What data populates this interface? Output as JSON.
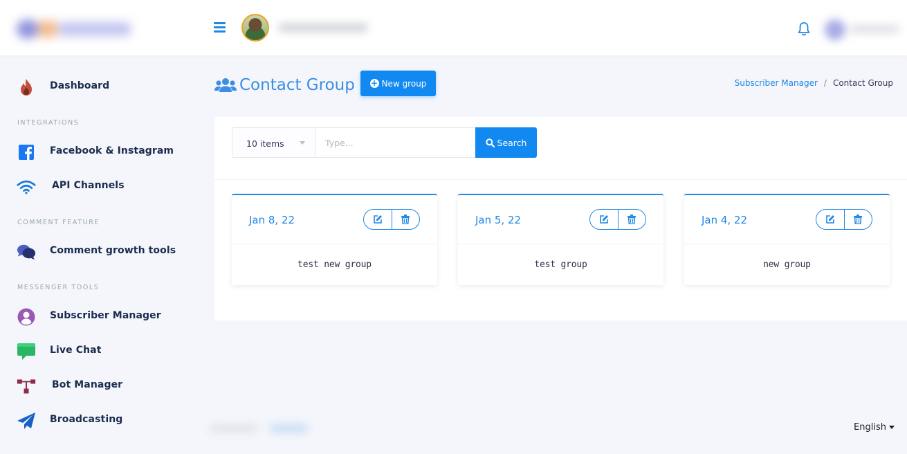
{
  "header": {
    "notifications_icon": "bell-icon",
    "menu_icon": "hamburger-icon"
  },
  "sidebar": {
    "items": [
      {
        "label": "Dashboard",
        "icon": "fire-icon"
      },
      {
        "label": "Facebook & Instagram",
        "icon": "facebook-icon"
      },
      {
        "label": "API Channels",
        "icon": "wifi-icon"
      },
      {
        "label": "Comment growth tools",
        "icon": "comments-icon"
      },
      {
        "label": "Subscriber Manager",
        "icon": "user-circle-icon"
      },
      {
        "label": "Live Chat",
        "icon": "chat-bubble-icon"
      },
      {
        "label": "Bot Manager",
        "icon": "sitemap-icon"
      },
      {
        "label": "Broadcasting",
        "icon": "paper-plane-icon"
      }
    ],
    "sections": {
      "integrations": "INTEGRATIONS",
      "comment_feature": "COMMENT FEATURE",
      "messenger_tools": "MESSENGER TOOLS"
    }
  },
  "page": {
    "title": "Contact Group",
    "new_button": "New group",
    "breadcrumb": {
      "parent": "Subscriber Manager",
      "separator": "/",
      "current": "Contact Group"
    }
  },
  "filter": {
    "items_select": "10 items",
    "search_placeholder": "Type...",
    "search_button": "Search"
  },
  "groups": [
    {
      "date": "Jan 8, 22",
      "name": "test new group"
    },
    {
      "date": "Jan 5, 22",
      "name": "test group"
    },
    {
      "date": "Jan 4, 22",
      "name": "new group"
    }
  ],
  "footer": {
    "language": "English"
  },
  "colors": {
    "accent": "#1e88e5",
    "button": "#1289f0",
    "sidebar_text": "#1b2c4d",
    "section_text": "#98a6ad"
  }
}
